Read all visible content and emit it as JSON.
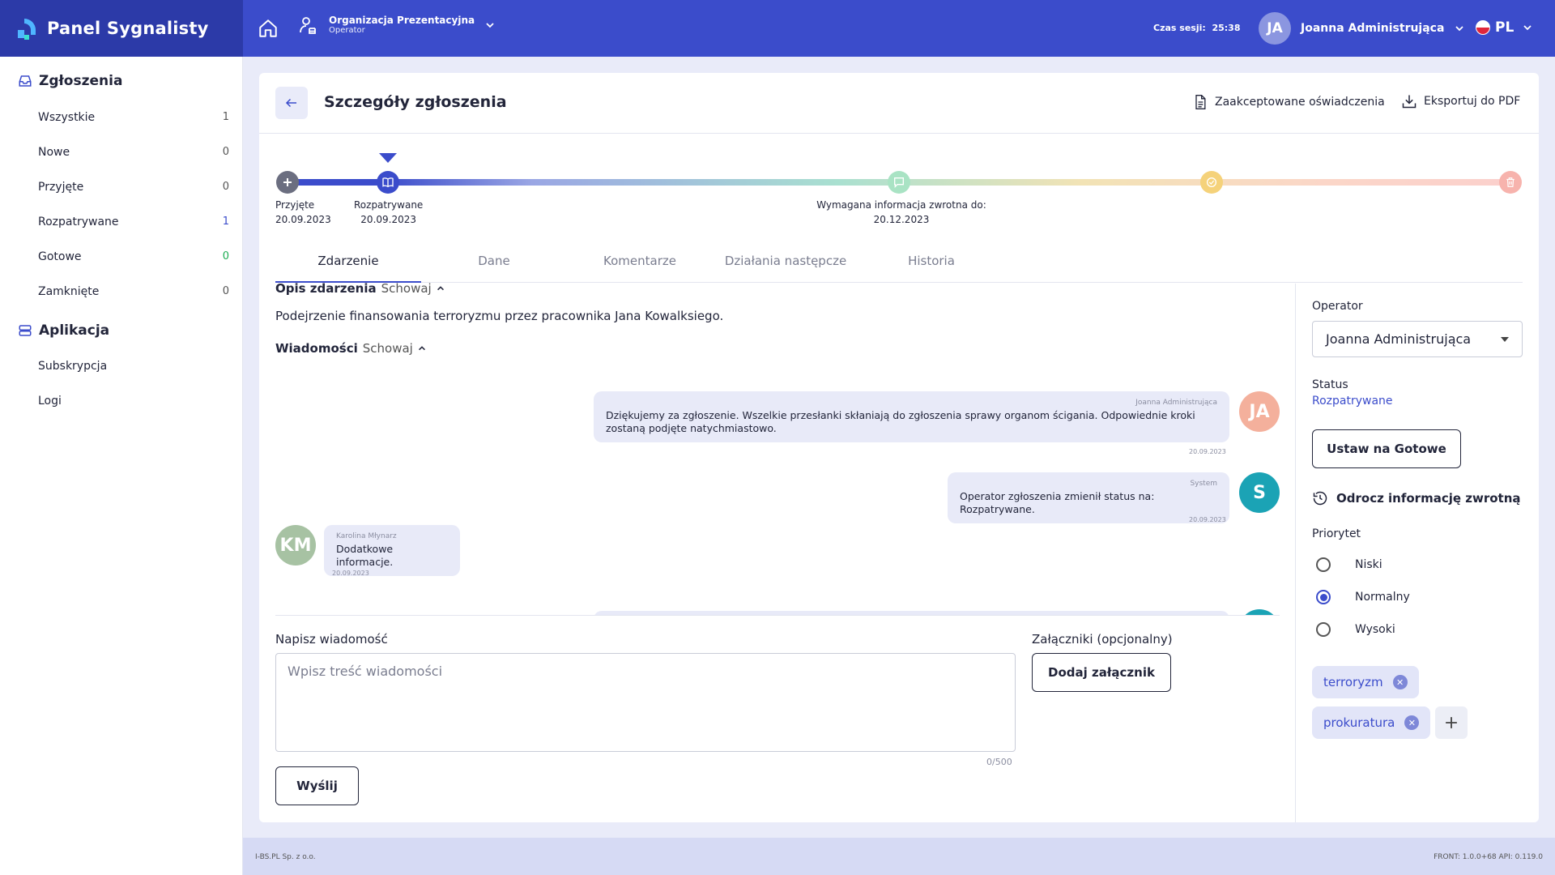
{
  "brand": {
    "name": "Panel Sygnalisty"
  },
  "topbar": {
    "org_name": "Organizacja Prezentacyjna",
    "org_role": "Operator",
    "session_label": "Czas sesji:",
    "session_time": "25:38",
    "user_initials": "JA",
    "user_name": "Joanna Administrująca",
    "lang": "PL"
  },
  "sidebar": {
    "section1": "Zgłoszenia",
    "items": [
      {
        "label": "Wszystkie",
        "count": "1"
      },
      {
        "label": "Nowe",
        "count": "0"
      },
      {
        "label": "Przyjęte",
        "count": "0"
      },
      {
        "label": "Rozpatrywane",
        "count": "1"
      },
      {
        "label": "Gotowe",
        "count": "0"
      },
      {
        "label": "Zamknięte",
        "count": "0"
      }
    ],
    "section2": "Aplikacja",
    "app_items": [
      {
        "label": "Subskrypcja"
      },
      {
        "label": "Logi"
      }
    ]
  },
  "header": {
    "title": "Szczegóły zgłoszenia",
    "accepted_statements": "Zaakceptowane oświadczenia",
    "export_pdf": "Eksportuj do PDF"
  },
  "progress": {
    "stages": [
      {
        "name": "Przyjęte",
        "date": "20.09.2023"
      },
      {
        "name": "Rozpatrywane",
        "date": "20.09.2023"
      }
    ],
    "feedback_label": "Wymagana informacja zwrotna do:",
    "feedback_date": "20.12.2023",
    "colors": {
      "done": "#6b6e80",
      "current": "#3b4ccb",
      "feedback": "#a9e3c4",
      "ready": "#f5d27a",
      "closed": "#f7b3ad"
    }
  },
  "tabs": [
    "Zdarzenie",
    "Dane",
    "Komentarze",
    "Działania następcze",
    "Historia"
  ],
  "content": {
    "desc_title": "Opis zdarzenia",
    "desc_toggle": "Schowaj",
    "description": "Podejrzenie finansowania terroryzmu przez pracownika Jana Kowalksiego.",
    "msgs_title": "Wiadomości",
    "msgs_toggle": "Schowaj"
  },
  "messages": [
    {
      "author": "Joanna Administrująca",
      "text": "Dziękujemy za zgłoszenie. Wszelkie przesłanki skłaniają do zgłoszenia sprawy organom ścigania. Odpowiednie kroki zostaną podjęte natychmiastowo.",
      "date": "20.09.2023",
      "initials": "JA",
      "avatar_color": "#f4b09c"
    },
    {
      "author": "System",
      "text": "Operator zgłoszenia zmienił status na: Rozpatrywane.",
      "date": "20.09.2023",
      "initials": "S",
      "avatar_color": "#1ba3b5"
    },
    {
      "author": "Karolina Młynarz",
      "text": "Dodatkowe informacje.",
      "date": "20.09.2023",
      "initials": "KM",
      "avatar_color": "#a7c2a3"
    }
  ],
  "compose": {
    "label": "Napisz wiadomość",
    "placeholder": "Wpisz treść wiadomości",
    "counter": "0/500",
    "send": "Wyślij",
    "attach_label": "Załączniki (opcjonalny)",
    "attach_button": "Dodaj załącznik"
  },
  "panel": {
    "operator_label": "Operator",
    "operator_value": "Joanna Administrująca",
    "status_label": "Status",
    "status_value": "Rozpatrywane",
    "set_ready": "Ustaw na Gotowe",
    "defer": "Odrocz informację zwrotną",
    "priority_label": "Priorytet",
    "priorities": [
      "Niski",
      "Normalny",
      "Wysoki"
    ],
    "priority_selected": "Normalny",
    "tags": [
      "terroryzm",
      "prokuratura"
    ]
  },
  "footer": {
    "company": "I-BS.PL Sp. z o.o.",
    "version": "FRONT: 1.0.0+68  API: 0.119.0"
  }
}
